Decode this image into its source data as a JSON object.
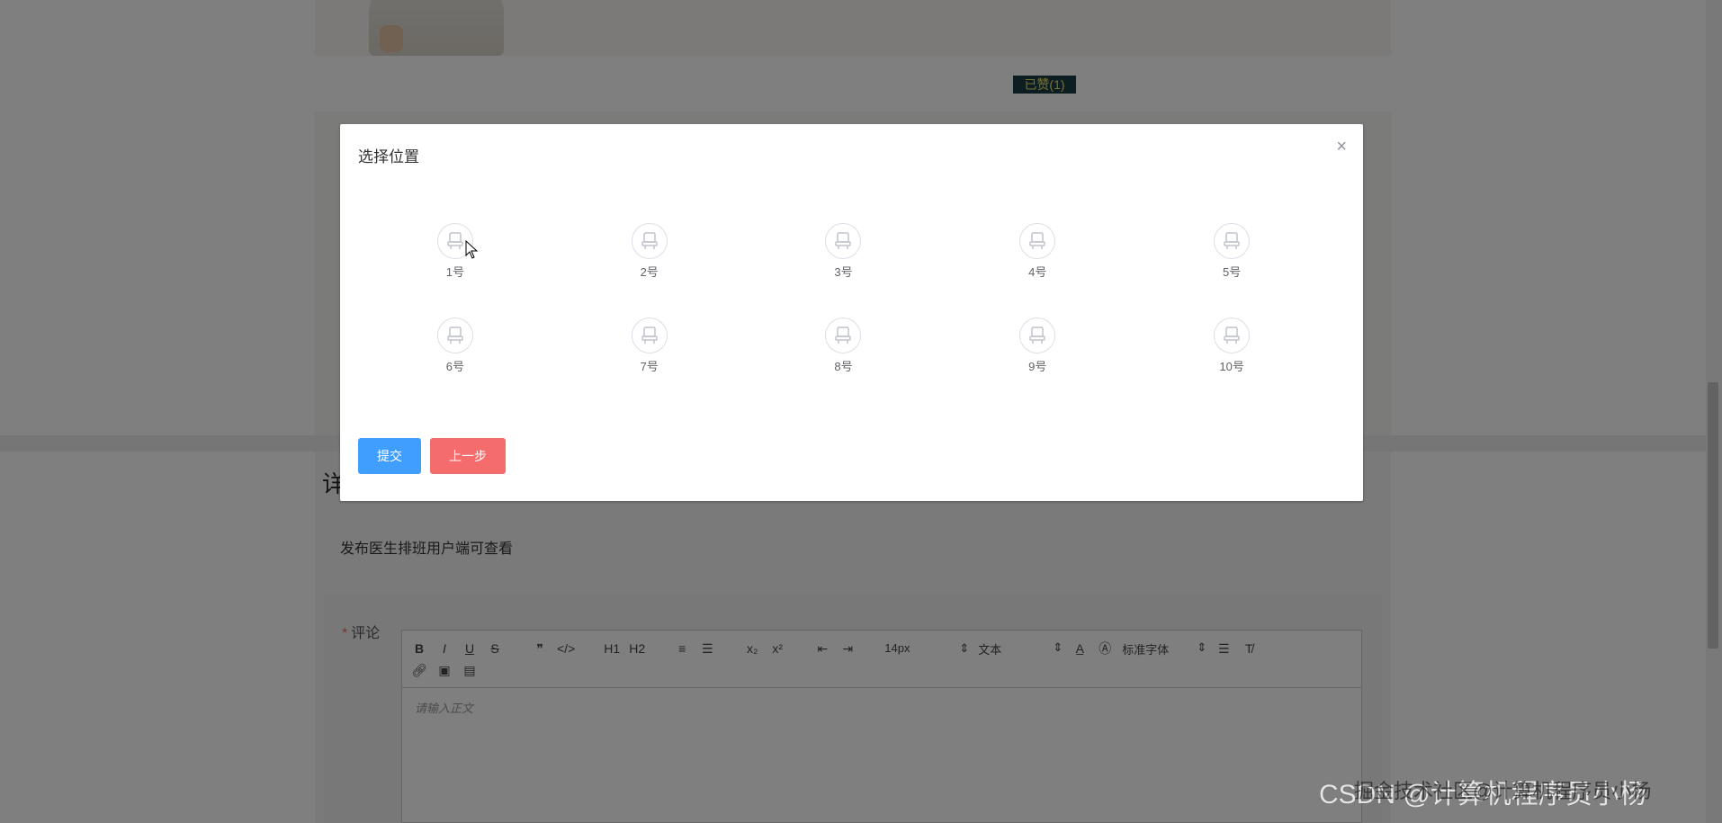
{
  "background": {
    "like_badge": "已赞(1)",
    "detail_title": "详",
    "detail_text": "发布医生排班用户端可查看",
    "comment_label": "评论",
    "comment_required_mark": "*",
    "editor": {
      "toolbar_row1": [
        "B",
        "I",
        "U",
        "S",
        "❞",
        "</>",
        "H1",
        "H2",
        "≡",
        "☰",
        "x₂",
        "x²",
        "⇤",
        "⇥"
      ],
      "font_size": "14px",
      "heading": "文本",
      "font_family": "标准字体",
      "placeholder": "请输入正文"
    }
  },
  "dialog": {
    "title": "选择位置",
    "close": "×",
    "seats": [
      {
        "label": "1号"
      },
      {
        "label": "2号"
      },
      {
        "label": "3号"
      },
      {
        "label": "4号"
      },
      {
        "label": "5号"
      },
      {
        "label": "6号"
      },
      {
        "label": "7号"
      },
      {
        "label": "8号"
      },
      {
        "label": "9号"
      },
      {
        "label": "10号"
      }
    ],
    "submit_label": "提交",
    "prev_label": "上一步"
  },
  "watermark": {
    "main": "CSDN @计算机程序员小杨",
    "overlay": "掘金技术社区@计算机程序员小杨"
  },
  "colors": {
    "primary": "#409eff",
    "danger": "#f56c6c",
    "like_bg": "#1a3d45",
    "like_fg": "#f1e26a"
  }
}
